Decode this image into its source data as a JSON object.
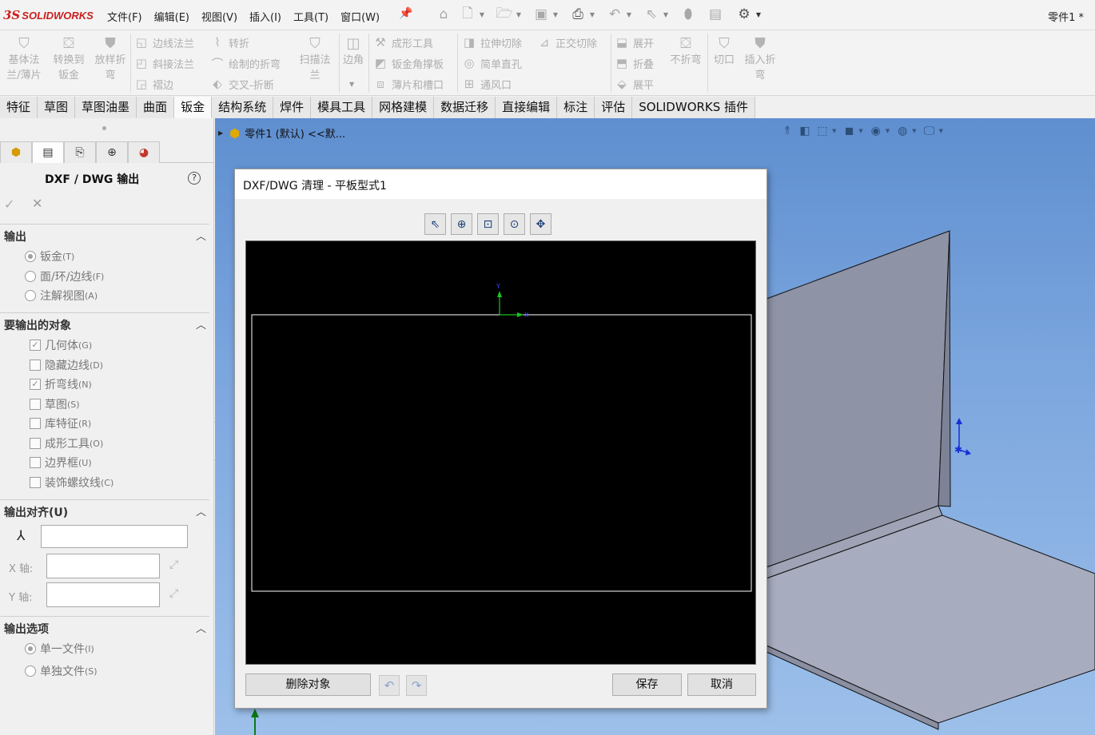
{
  "app": {
    "logo_mark": "3S",
    "brand": "SOLIDWORKS",
    "document_title": "零件1 *"
  },
  "menu": [
    "文件(F)",
    "编辑(E)",
    "视图(V)",
    "插入(I)",
    "工具(T)",
    "窗口(W)"
  ],
  "quick_access": [
    "home-icon",
    "new-document-icon",
    "open-folder-icon",
    "save-icon",
    "print-icon",
    "undo-icon",
    "select-cursor-icon",
    "rebuild-icon",
    "file-properties-icon",
    "options-gear-icon"
  ],
  "ribbon": {
    "base_flange": "基体法兰/薄片",
    "convert_to_sheet_metal": "转换到钣金",
    "lofted_bend": "放样折弯",
    "edge_flange": "边线法兰",
    "miter_flange": "斜接法兰",
    "hem": "褶边",
    "jog": "转折",
    "sketched_bend": "绘制的折弯",
    "cross_break": "交叉-折断",
    "swept_flange": "扫描法兰",
    "corners": "边角",
    "forming_tool": "成形工具",
    "sheet_metal_gusset": "钣金角撑板",
    "tab_and_slot": "薄片和槽口",
    "extruded_cut": "拉伸切除",
    "simple_hole": "简单直孔",
    "vent": "通风口",
    "normal_cut": "正交切除",
    "unfold": "展开",
    "fold": "折叠",
    "flatten": "展平",
    "no_bends": "不折弯",
    "rip": "切口",
    "insert_bends": "插入折弯"
  },
  "tabs": [
    "特征",
    "草图",
    "草图油墨",
    "曲面",
    "钣金",
    "结构系统",
    "焊件",
    "模具工具",
    "网格建模",
    "数据迁移",
    "直接编辑",
    "标注",
    "评估",
    "SOLIDWORKS 插件"
  ],
  "active_tab": "钣金",
  "property_manager": {
    "title": "DXF / DWG 输出",
    "help": "?",
    "ok": "✓",
    "cancel": "✕",
    "output": {
      "heading": "输出",
      "options": [
        {
          "label": "钣金",
          "hotkey": "(T)",
          "selected": true
        },
        {
          "label": "面/环/边线",
          "hotkey": "(F)",
          "selected": false
        },
        {
          "label": "注解视图",
          "hotkey": "(A)",
          "selected": false
        }
      ]
    },
    "entities_to_export": {
      "heading": "要输出的对象",
      "items": [
        {
          "label": "几何体",
          "hotkey": "(G)",
          "checked": true
        },
        {
          "label": "隐藏边线",
          "hotkey": "(D)",
          "checked": false
        },
        {
          "label": "折弯线",
          "hotkey": "(N)",
          "checked": true
        },
        {
          "label": "草图",
          "hotkey": "(S)",
          "checked": false
        },
        {
          "label": "库特征",
          "hotkey": "(R)",
          "checked": false
        },
        {
          "label": "成形工具",
          "hotkey": "(O)",
          "checked": false
        },
        {
          "label": "边界框",
          "hotkey": "(U)",
          "checked": false
        },
        {
          "label": "装饰螺纹线",
          "hotkey": "(C)",
          "checked": false
        }
      ]
    },
    "alignment": {
      "heading": "输出对齐(U)",
      "origin_value": "",
      "x_axis_label": "X 轴:",
      "x_axis_value": "",
      "y_axis_label": "Y 轴:",
      "y_axis_value": ""
    },
    "export_options": {
      "heading": "输出选项",
      "options": [
        {
          "label": "单一文件",
          "hotkey": "(I)",
          "selected": true
        },
        {
          "label": "单独文件",
          "hotkey": "(S)",
          "selected": false
        }
      ]
    }
  },
  "graphics": {
    "breadcrumb": "零件1 (默认) <<默..."
  },
  "dialog": {
    "title": "DXF/DWG 清理 - 平板型式1",
    "tools": [
      "select-entity-icon",
      "zoom-to-fit-icon",
      "zoom-to-area-icon",
      "zoom-in-out-icon",
      "pan-icon"
    ],
    "delete_button": "删除对象",
    "save_button": "保存",
    "cancel_button": "取消"
  }
}
